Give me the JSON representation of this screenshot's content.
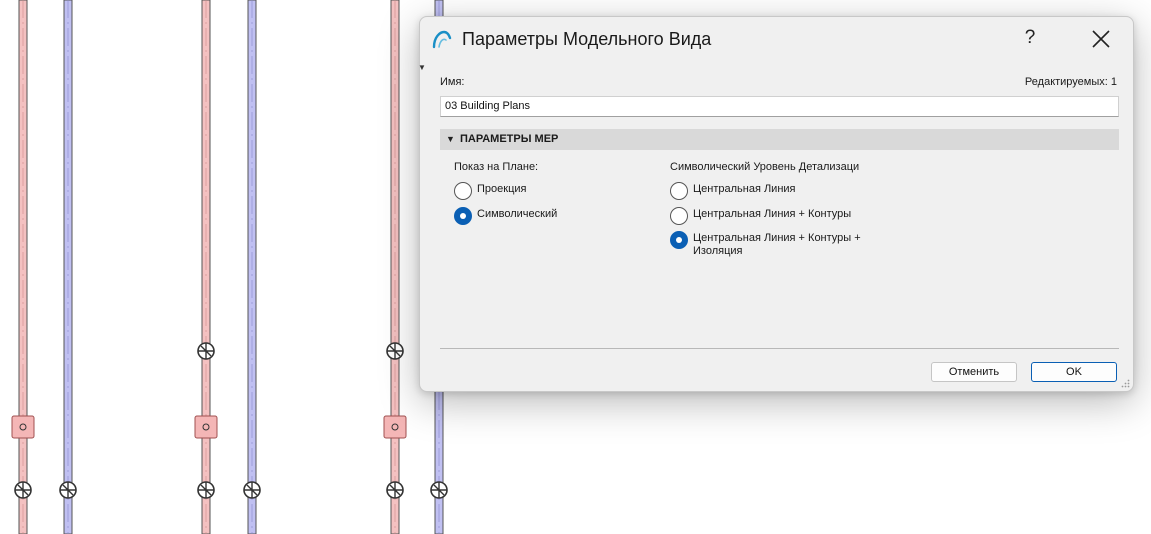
{
  "dialog": {
    "title": "Параметры Модельного Вида",
    "help_label": "?",
    "name_label": "Имя:",
    "editable_label": "Редактируемых: 1",
    "name_value": "03 Building Plans",
    "section_title": "ПАРАМЕТРЫ МЕР",
    "plan_display": {
      "label": "Показ на Плане:",
      "options": [
        {
          "label": "Проекция",
          "selected": false
        },
        {
          "label": "Символический",
          "selected": true
        }
      ]
    },
    "detail_level": {
      "label": "Символический Уровень Детализаци",
      "options": [
        {
          "label": "Центральная Линия",
          "selected": false
        },
        {
          "label": "Центральная Линия + Контуры",
          "selected": false
        },
        {
          "label": "Центральная Линия + Контуры + Изоляция",
          "selected": true
        }
      ]
    },
    "cancel_label": "Отменить",
    "ok_label": "OK"
  },
  "colors": {
    "accent": "#0a5fb4",
    "pipe_pink": "#f2b8b8",
    "pipe_blue": "#b8b8f2",
    "dialog_bg": "#f0f0f0"
  }
}
